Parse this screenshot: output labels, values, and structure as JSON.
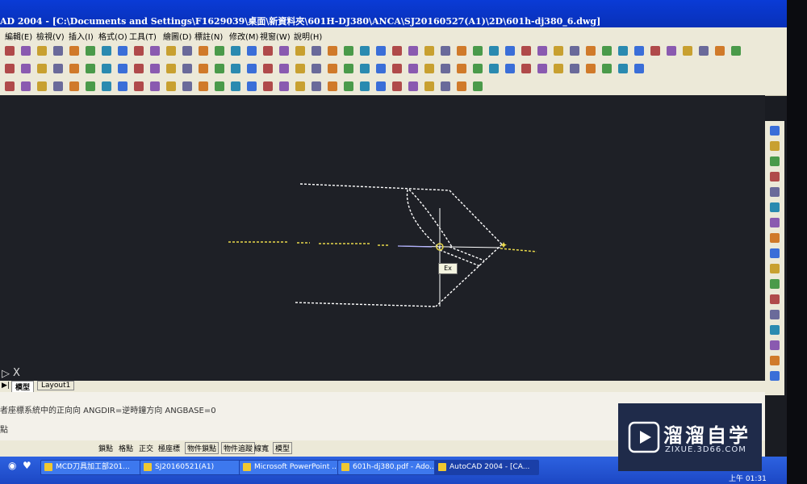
{
  "window": {
    "title": "AD 2004 - [C:\\Documents and Settings\\F1629039\\桌面\\新資料夾\\601H-DJ380\\ANCA\\SJ20160527(A1)\\2D\\601h-dj380_6.dwg]"
  },
  "menu": [
    "編輯(E)",
    "檢視(V)",
    "插入(I)",
    "格式(O)",
    "工具(T)",
    "繪圖(D)",
    "標註(N)",
    "修改(M)",
    "視窗(W)",
    "說明(H)"
  ],
  "tabs": {
    "model": "模型",
    "layout": "Layout1"
  },
  "command": {
    "line1": "者座標系統中的正向向    ANGDIR=逆時鐘方向    ANGBASE=0",
    "prompt": "點"
  },
  "status_toggles": [
    "鎖點",
    "格點",
    "正交",
    "極座標",
    "物件鎖點",
    "物件追蹤",
    "線寬",
    "模型"
  ],
  "ucs_label": "X",
  "cursor_tooltip": "Ex",
  "taskbar": {
    "items": [
      "MCD刀具加工部201...",
      "SJ20160521(A1)",
      "Microsoft PowerPoint ...",
      "601h-dj380.pdf - Ado...",
      "AutoCAD 2004 - [CA..."
    ],
    "clock": "上午 01:31"
  },
  "watermark": {
    "name": "溜溜自学",
    "url": "ZIXUE.3D66.COM"
  },
  "colors": {
    "title_bar": "#0a3bd6",
    "drawing_bg": "#1e2026",
    "yellow_centerline": "#e8d84a",
    "white_lines": "#ffffff"
  }
}
